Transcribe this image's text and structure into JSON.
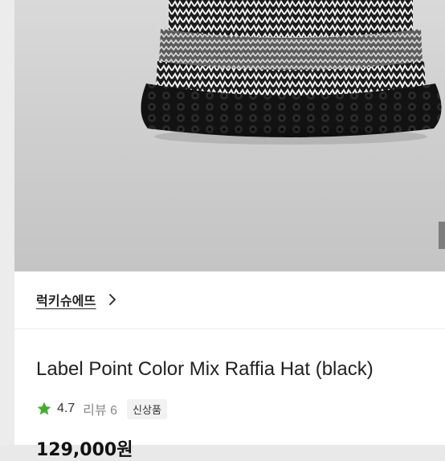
{
  "product": {
    "brand": "럭키슈에뜨",
    "title": "Label Point Color Mix Raffia Hat (black)",
    "rating": "4.7",
    "reviews": "리뷰 6",
    "badge": "신상품",
    "price": "129,000원"
  },
  "icons": {
    "brand_chevron": "chevron-right-icon",
    "rating_star": "star-icon"
  },
  "colors": {
    "star": "#43b02a",
    "text": "#222222",
    "muted": "#888888"
  }
}
